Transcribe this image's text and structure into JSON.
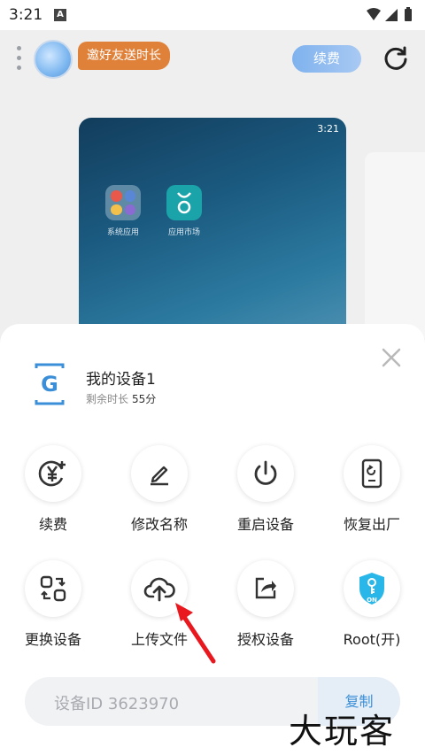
{
  "status_bar": {
    "time": "3:21",
    "notif_letter": "A"
  },
  "top_bar": {
    "invite_label": "邀好友送时长",
    "renew_label": "续费"
  },
  "phone_preview": {
    "time": "3:21",
    "apps": [
      {
        "label": "系统应用"
      },
      {
        "label": "应用市场"
      }
    ]
  },
  "sheet": {
    "device_name": "我的设备1",
    "remaining_label": "剩余时长",
    "remaining_value": "55分",
    "actions": [
      {
        "label": "续费",
        "icon": "yen-plus-icon"
      },
      {
        "label": "修改名称",
        "icon": "pen-icon"
      },
      {
        "label": "重启设备",
        "icon": "power-icon"
      },
      {
        "label": "恢复出厂",
        "icon": "factory-reset-icon"
      },
      {
        "label": "更换设备",
        "icon": "swap-device-icon"
      },
      {
        "label": "上传文件",
        "icon": "cloud-upload-icon"
      },
      {
        "label": "授权设备",
        "icon": "share-auth-icon"
      },
      {
        "label": "Root(开)",
        "icon": "root-key-icon",
        "badge": "ON"
      }
    ],
    "device_id": "设备ID 3623970",
    "copy_label": "复制"
  },
  "watermark": "大玩客",
  "colors": {
    "accent": "#3b8fd9",
    "invite": "#e0813a",
    "root_shield": "#29b6e8"
  }
}
